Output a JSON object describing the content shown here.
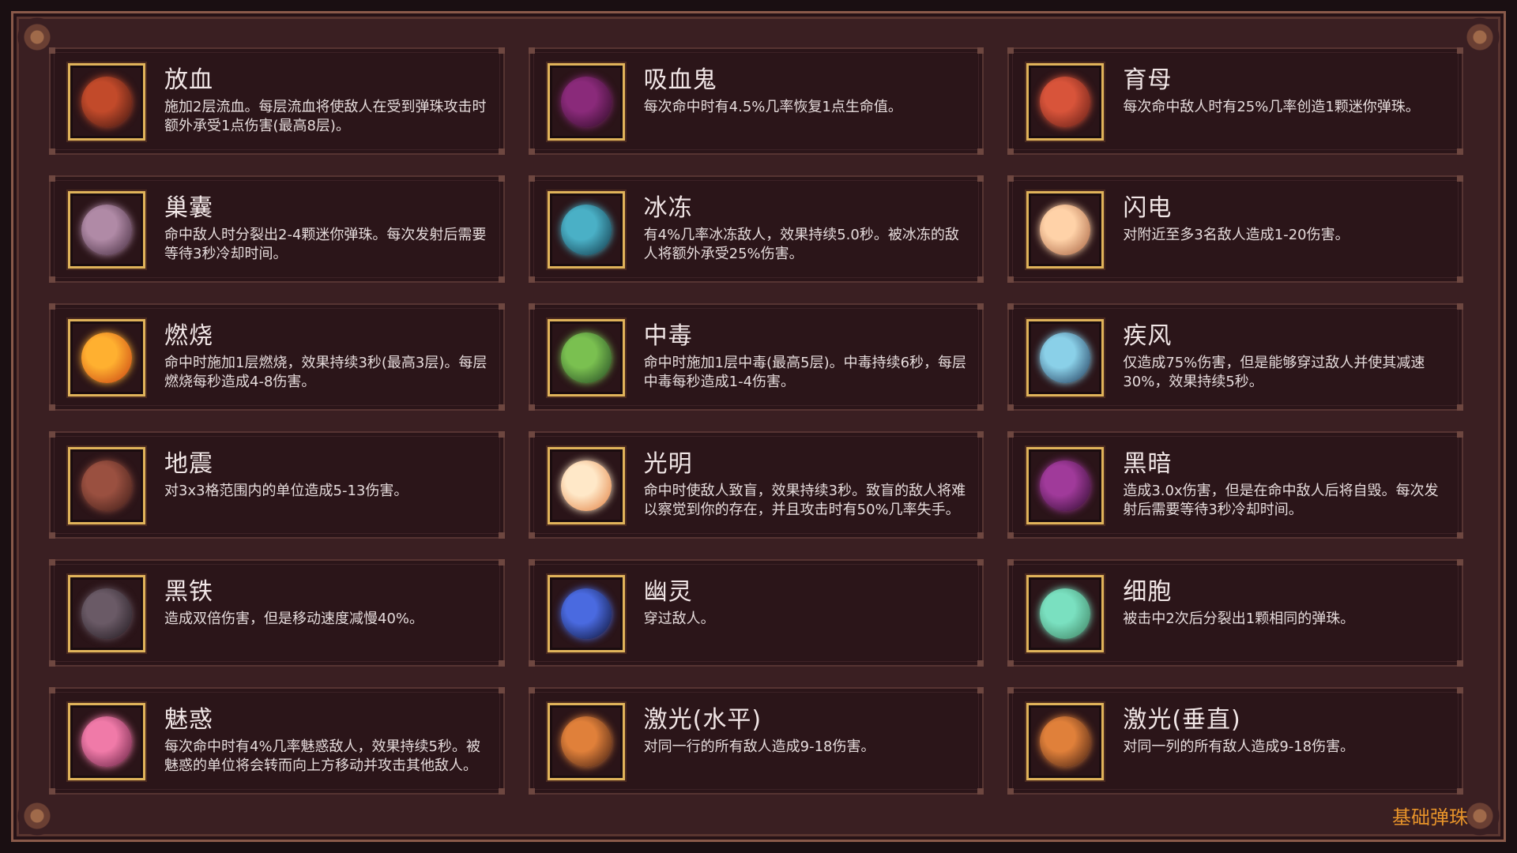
{
  "footer_label": "基础弹珠",
  "cards": [
    {
      "name": "放血",
      "desc": "施加2层流血。每层流血将使敌人在受到弹珠攻击时额外承受1点伤害(最高8层)。",
      "icon": "bleed-orb-icon",
      "colors": [
        "#c24a2a",
        "#3a1410"
      ]
    },
    {
      "name": "吸血鬼",
      "desc": "每次命中时有4.5%几率恢复1点生命值。",
      "icon": "vampire-orb-icon",
      "colors": [
        "#8a2a7a",
        "#2a0a22"
      ]
    },
    {
      "name": "育母",
      "desc": "每次命中敌人时有25%几率创造1颗迷你弹珠。",
      "icon": "brood-mother-icon",
      "colors": [
        "#d8543a",
        "#5a1a14"
      ]
    },
    {
      "name": "巢囊",
      "desc": "命中敌人时分裂出2-4颗迷你弹珠。每次发射后需要等待3秒冷却时间。",
      "icon": "egg-sac-icon",
      "colors": [
        "#b08aa6",
        "#3e2638"
      ]
    },
    {
      "name": "冰冻",
      "desc": "有4%几率冰冻敌人，效果持续5.0秒。被冰冻的敌人将额外承受25%伤害。",
      "icon": "frozen-orb-icon",
      "colors": [
        "#4ab0c6",
        "#0e3040"
      ]
    },
    {
      "name": "闪电",
      "desc": "对附近至多3名敌人造成1-20伤害。",
      "icon": "lightning-orb-icon",
      "colors": [
        "#ffd2a8",
        "#a05a3a"
      ]
    },
    {
      "name": "燃烧",
      "desc": "命中时施加1层燃烧，效果持续3秒(最高3层)。每层燃烧每秒造成4-8伤害。",
      "icon": "fire-orb-icon",
      "colors": [
        "#ffb030",
        "#c43a10"
      ]
    },
    {
      "name": "中毒",
      "desc": "命中时施加1层中毒(最高5层)。中毒持续6秒，每层中毒每秒造成1-4伤害。",
      "icon": "poison-orb-icon",
      "colors": [
        "#7ac050",
        "#1e4020"
      ]
    },
    {
      "name": "疾风",
      "desc": "仅造成75%伤害，但是能够穿过敌人并使其减速30%，效果持续5秒。",
      "icon": "gale-orb-icon",
      "colors": [
        "#8ad0e8",
        "#1a3050"
      ]
    },
    {
      "name": "地震",
      "desc": "对3x3格范围内的单位造成5-13伤害。",
      "icon": "earthquake-orb-icon",
      "colors": [
        "#9a5040",
        "#3a1a16"
      ]
    },
    {
      "name": "光明",
      "desc": "命中时使敌人致盲，效果持续3秒。致盲的敌人将难以察觉到你的存在，并且攻击时有50%几率失手。",
      "icon": "light-orb-icon",
      "colors": [
        "#ffe8c8",
        "#e07a3a"
      ]
    },
    {
      "name": "黑暗",
      "desc": "造成3.0x伤害，但是在命中敌人后将自毁。每次发射后需要等待3秒冷却时间。",
      "icon": "dark-orb-icon",
      "colors": [
        "#a03a9a",
        "#2a0a2a"
      ]
    },
    {
      "name": "黑铁",
      "desc": "造成双倍伤害，但是移动速度减慢40%。",
      "icon": "iron-orb-icon",
      "colors": [
        "#6a5a66",
        "#1e161c"
      ]
    },
    {
      "name": "幽灵",
      "desc": "穿过敌人。",
      "icon": "ghost-orb-icon",
      "colors": [
        "#4a6ae0",
        "#0a0e2a"
      ]
    },
    {
      "name": "细胞",
      "desc": "被击中2次后分裂出1颗相同的弹珠。",
      "icon": "cell-orb-icon",
      "colors": [
        "#7ae0c0",
        "#3a7a5a"
      ]
    },
    {
      "name": "魅惑",
      "desc": "每次命中时有4%几率魅惑敌人，效果持续5秒。被魅惑的单位将会转而向上方移动并攻击其他敌人。",
      "icon": "charm-orb-icon",
      "colors": [
        "#f07aa8",
        "#5a1a3a"
      ]
    },
    {
      "name": "激光(水平)",
      "desc": "对同一行的所有敌人造成9-18伤害。",
      "icon": "laser-horizontal-icon",
      "colors": [
        "#e0803a",
        "#3a1a10"
      ]
    },
    {
      "name": "激光(垂直)",
      "desc": "对同一列的所有敌人造成9-18伤害。",
      "icon": "laser-vertical-icon",
      "colors": [
        "#e0803a",
        "#3a1a10"
      ]
    }
  ]
}
